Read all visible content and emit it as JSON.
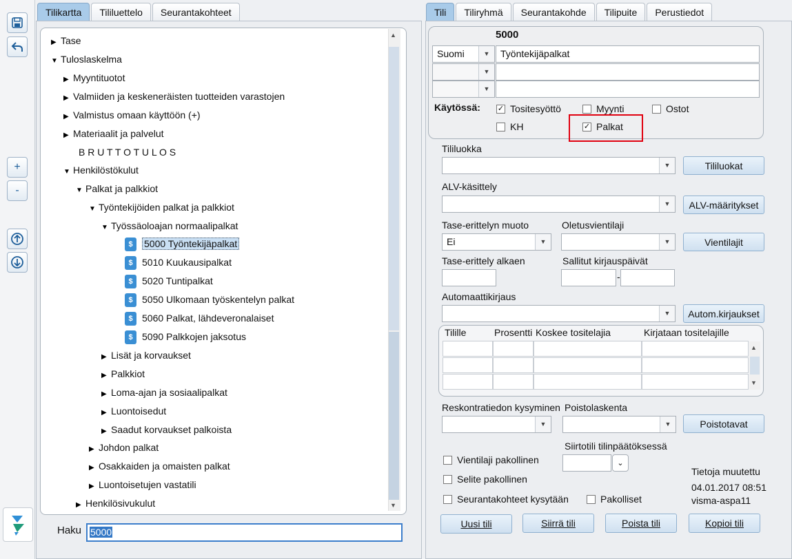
{
  "left_tabs": [
    "Tilikartta",
    "Tililuettelo",
    "Seurantakohteet"
  ],
  "right_tabs": [
    "Tili",
    "Tiliryhmä",
    "Seurantakohde",
    "Tilipuite",
    "Perustiedot"
  ],
  "toolbar": {
    "zoom_in": "+",
    "zoom_out": "-"
  },
  "tree": {
    "items": [
      {
        "label": "Tase"
      },
      {
        "label": "Tuloslaskelma"
      },
      {
        "label": "Myyntituotot"
      },
      {
        "label": "Valmiiden ja keskeneräisten tuotteiden varastojen"
      },
      {
        "label": "Valmistus omaan käyttöön (+)"
      },
      {
        "label": "Materiaalit ja palvelut"
      },
      {
        "label": "B R U T T O T U L O S"
      },
      {
        "label": "Henkilöstökulut"
      },
      {
        "label": "Palkat ja palkkiot"
      },
      {
        "label": "Työntekijöiden palkat ja palkkiot"
      },
      {
        "label": "Työssäoloajan normaalipalkat"
      },
      {
        "label": "5000 Työntekijäpalkat"
      },
      {
        "label": "5010 Kuukausipalkat"
      },
      {
        "label": "5020 Tuntipalkat"
      },
      {
        "label": "5050 Ulkomaan työskentelyn palkat"
      },
      {
        "label": "5060 Palkat, lähdeveronalaiset"
      },
      {
        "label": "5090 Palkkojen jaksotus"
      },
      {
        "label": "Lisät ja korvaukset"
      },
      {
        "label": "Palkkiot"
      },
      {
        "label": "Loma-ajan ja sosiaalipalkat"
      },
      {
        "label": "Luontoisedut"
      },
      {
        "label": "Saadut korvaukset palkoista"
      },
      {
        "label": "Johdon palkat"
      },
      {
        "label": "Osakkaiden ja omaisten palkat"
      },
      {
        "label": "Luontoisetujen vastatili"
      },
      {
        "label": "Henkilösivukulut"
      }
    ]
  },
  "search": {
    "label": "Haku",
    "value": "5000"
  },
  "account": {
    "number": "5000",
    "language": "Suomi",
    "name": "Työntekijäpalkat",
    "in_use_label": "Käytössä:",
    "checks": {
      "tositesyotto": {
        "label": "Tositesyöttö",
        "checked": true
      },
      "myynti": {
        "label": "Myynti",
        "checked": false
      },
      "ostot": {
        "label": "Ostot",
        "checked": false
      },
      "kh": {
        "label": "KH",
        "checked": false
      },
      "palkat": {
        "label": "Palkat",
        "checked": true
      }
    }
  },
  "form": {
    "tililuokka_label": "Tililuokka",
    "tililuokat_button": "Tililuokat",
    "alv_label": "ALV-käsittely",
    "alv_button": "ALV-määritykset",
    "tase_muoto_label": "Tase-erittelyn muoto",
    "tase_muoto_value": "Ei",
    "oletus_label": "Oletusvientilaji",
    "vientilajit_button": "Vientilajit",
    "tase_alkaen_label": "Tase-erittely alkaen",
    "sallitut_label": "Sallitut kirjauspäivät",
    "date_sep": "-",
    "auto_label": "Automaattikirjaus",
    "auto_button": "Autom.kirjaukset",
    "grid_headers": [
      "Tilille",
      "Prosentti",
      "Koskee tositelajia",
      "Kirjataan tositelajille"
    ],
    "reskontra_label": "Reskontratiedon kysyminen",
    "poisto_label": "Poistolaskenta",
    "poistotavat_button": "Poistotavat",
    "siirto_label": "Siirtotili tilinpäätöksessä",
    "vientilaji_pakollinen": "Vientilaji pakollinen",
    "selite_pakollinen": "Selite pakollinen",
    "seuranta_kysytaan": "Seurantakohteet kysytään",
    "pakolliset": "Pakolliset",
    "modified_title": "Tietoja muutettu",
    "modified_date": "04.01.2017 08:51",
    "modified_user": "visma-aspa11"
  },
  "actions": {
    "uusi": "Uusi tili",
    "siirra": "Siirrä tili",
    "poista": "Poista tili",
    "kopioi": "Kopioi tili"
  },
  "colors": {
    "active_tab": "#a9cbe9",
    "highlight_box": "#e0000f"
  }
}
